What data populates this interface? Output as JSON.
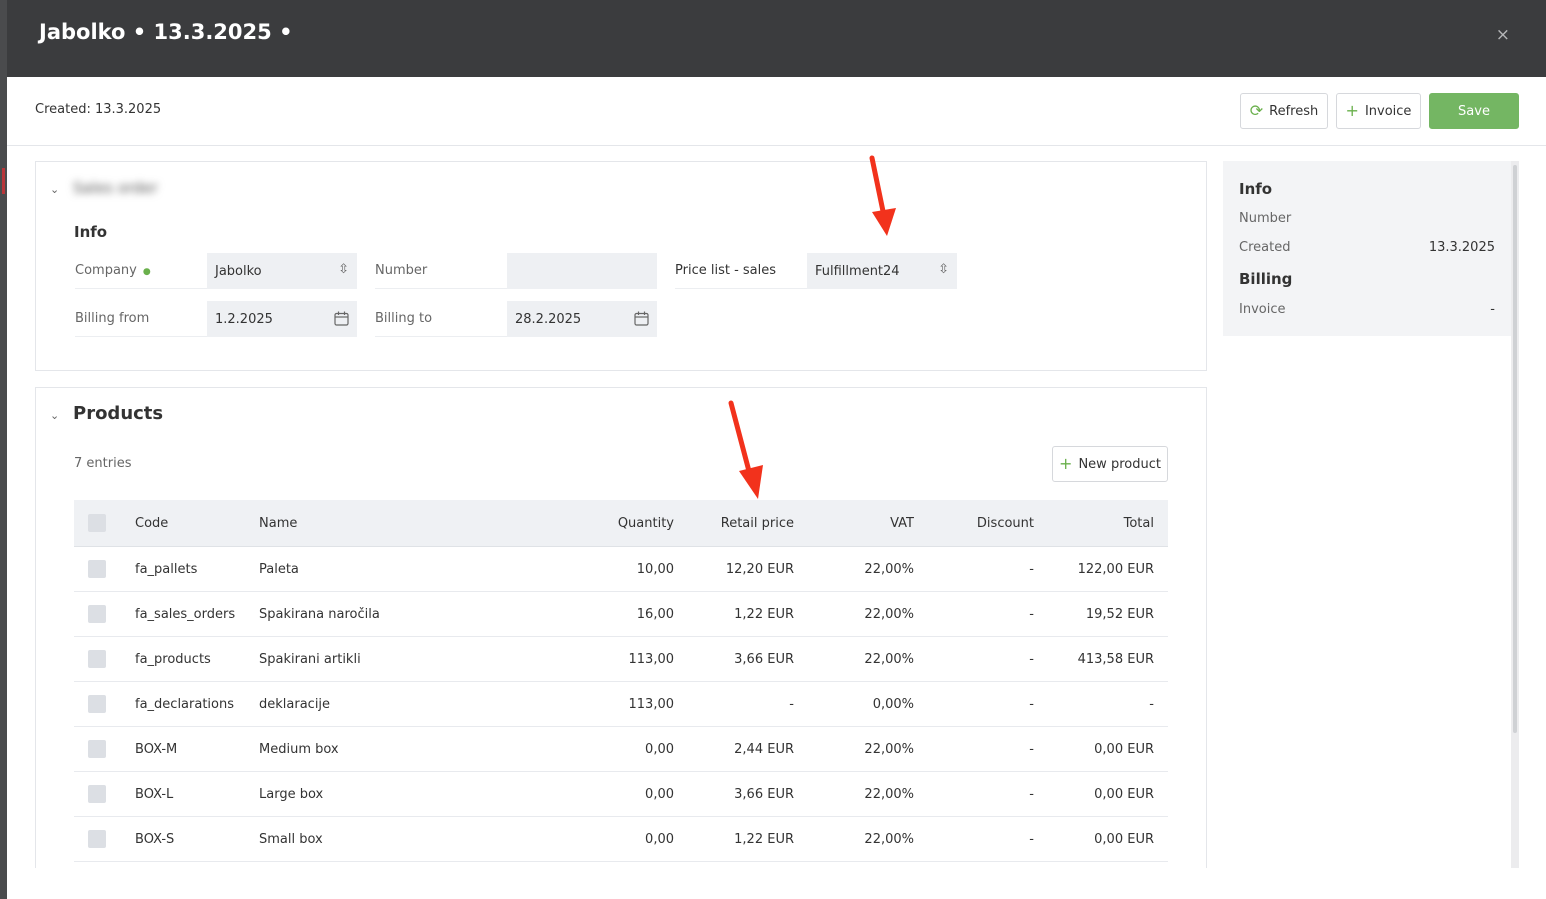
{
  "window": {
    "title": "Jabolko • 13.3.2025 •",
    "close_glyph": "×"
  },
  "toolbar": {
    "created_text": "Created: 13.3.2025",
    "refresh_label": "Refresh",
    "invoice_label": "Invoice",
    "save_label": "Save"
  },
  "colors": {
    "accent_green": "#74b663",
    "icon_green": "#6ab04c",
    "header_bg": "#3b3c3e",
    "arrow_red": "#f2321c"
  },
  "sales_order": {
    "heading": "Sales order",
    "info_heading": "Info",
    "company_label": "Company",
    "company_value": "Jabolko",
    "number_label": "Number",
    "number_value": "",
    "price_list_label": "Price list - sales",
    "price_list_value": "Fulfillment24",
    "billing_from_label": "Billing from",
    "billing_from_value": "1.2.2025",
    "billing_to_label": "Billing to",
    "billing_to_value": "28.2.2025"
  },
  "products": {
    "title": "Products",
    "entries": "7 entries",
    "new_product_label": "New product",
    "columns": [
      "Code",
      "Name",
      "Quantity",
      "Retail price",
      "VAT",
      "Discount",
      "Total"
    ],
    "rows": [
      {
        "code": "fa_pallets",
        "name": "Paleta",
        "quantity": "10,00",
        "retail_price": "12,20 EUR",
        "vat": "22,00%",
        "discount": "-",
        "total": "122,00 EUR"
      },
      {
        "code": "fa_sales_orders",
        "name": "Spakirana naročila",
        "quantity": "16,00",
        "retail_price": "1,22 EUR",
        "vat": "22,00%",
        "discount": "-",
        "total": "19,52 EUR"
      },
      {
        "code": "fa_products",
        "name": "Spakirani artikli",
        "quantity": "113,00",
        "retail_price": "3,66 EUR",
        "vat": "22,00%",
        "discount": "-",
        "total": "413,58 EUR"
      },
      {
        "code": "fa_declarations",
        "name": "deklaracije",
        "quantity": "113,00",
        "retail_price": "-",
        "vat": "0,00%",
        "discount": "-",
        "total": "-"
      },
      {
        "code": "BOX-M",
        "name": "Medium box",
        "quantity": "0,00",
        "retail_price": "2,44 EUR",
        "vat": "22,00%",
        "discount": "-",
        "total": "0,00 EUR"
      },
      {
        "code": "BOX-L",
        "name": "Large box",
        "quantity": "0,00",
        "retail_price": "3,66 EUR",
        "vat": "22,00%",
        "discount": "-",
        "total": "0,00 EUR"
      },
      {
        "code": "BOX-S",
        "name": "Small box",
        "quantity": "0,00",
        "retail_price": "1,22 EUR",
        "vat": "22,00%",
        "discount": "-",
        "total": "0,00 EUR"
      }
    ]
  },
  "sidebar": {
    "info_heading": "Info",
    "number_label": "Number",
    "number_value": "",
    "created_label": "Created",
    "created_value": "13.3.2025",
    "billing_heading": "Billing",
    "invoice_label": "Invoice",
    "invoice_value": "-"
  }
}
